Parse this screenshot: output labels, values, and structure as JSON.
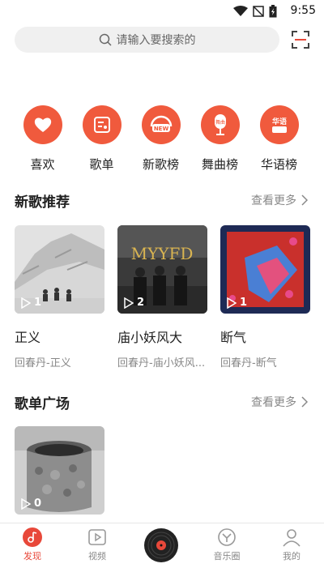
{
  "status": {
    "time": "9:55"
  },
  "search": {
    "placeholder": "请输入要搜索的"
  },
  "categories": [
    {
      "label": "喜欢",
      "icon": "heart-icon"
    },
    {
      "label": "歌单",
      "icon": "playlist-icon"
    },
    {
      "label": "新歌榜",
      "icon": "new-badge-icon"
    },
    {
      "label": "舞曲榜",
      "icon": "microphone-icon",
      "badge": "舞曲"
    },
    {
      "label": "华语榜",
      "icon": "chinese-chart-icon",
      "badge": "华语"
    }
  ],
  "new_songs": {
    "title": "新歌推荐",
    "more": "查看更多",
    "items": [
      {
        "title": "正义",
        "subtitle": "回春丹-正义",
        "plays": "1"
      },
      {
        "title": "庙小妖风大",
        "subtitle": "回春丹-庙小妖风...",
        "plays": "2",
        "cover_text": "MYYFD"
      },
      {
        "title": "断气",
        "subtitle": "回春丹-断气",
        "plays": "1"
      }
    ]
  },
  "playlists": {
    "title": "歌单广场",
    "more": "查看更多",
    "items": [
      {
        "plays": "0"
      }
    ]
  },
  "tabs": [
    {
      "label": "发现",
      "active": true
    },
    {
      "label": "视频"
    },
    {
      "label": ""
    },
    {
      "label": "音乐圈"
    },
    {
      "label": "我的"
    }
  ],
  "colors": {
    "accent": "#f05a3d",
    "active_tab": "#e8483a"
  }
}
